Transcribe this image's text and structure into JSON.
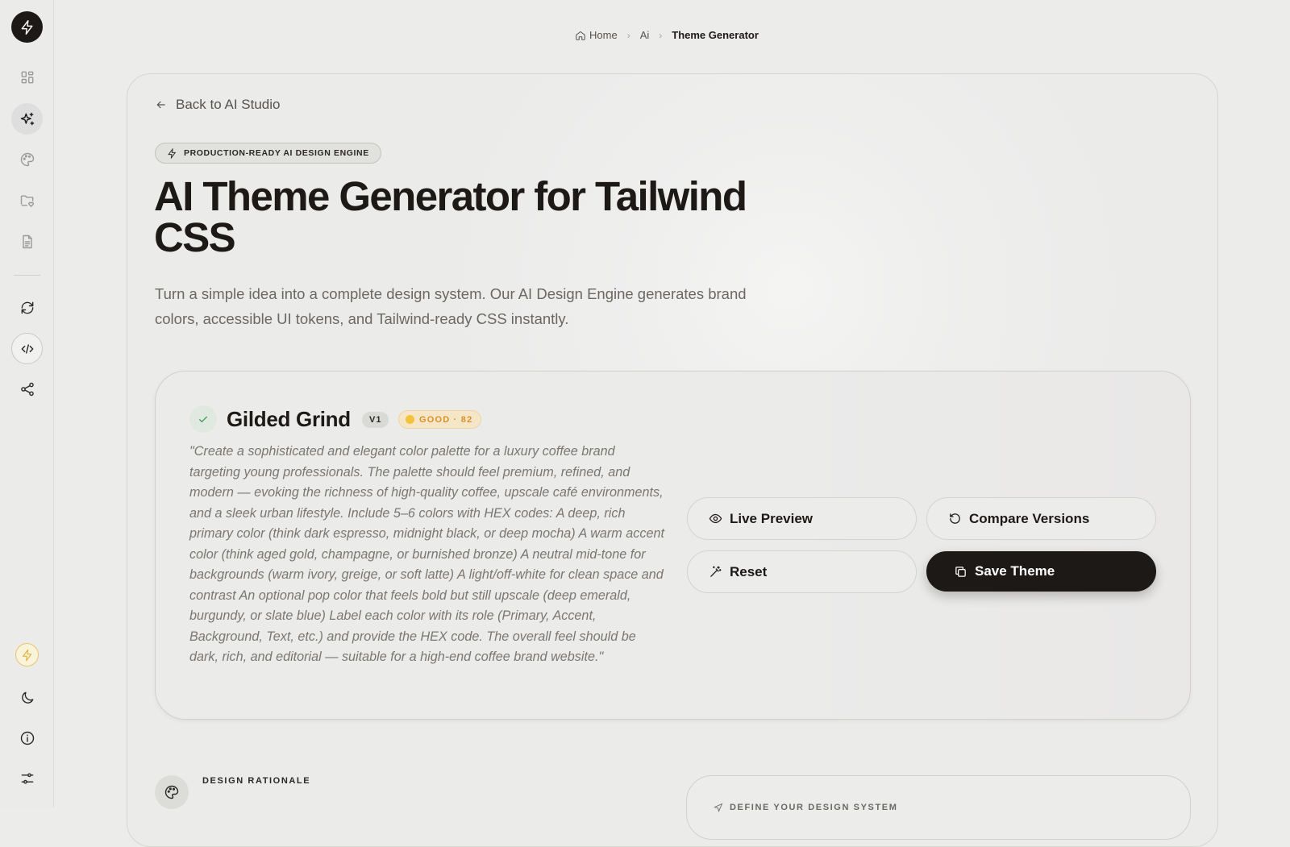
{
  "sidebar": {
    "icons": [
      "bolt-icon",
      "grid-icon",
      "sparkles-icon",
      "palette-icon",
      "folder-heart-icon",
      "document-icon",
      "refresh-icon",
      "code-icon",
      "share-icon",
      "bolt-icon",
      "moon-icon",
      "info-icon",
      "sliders-icon"
    ],
    "accent_color": "#e0b23a"
  },
  "breadcrumb": {
    "home": "Home",
    "ai": "Ai",
    "current": "Theme Generator"
  },
  "header": {
    "back_label": "Back to AI Studio",
    "badge": "PRODUCTION-READY AI DESIGN ENGINE",
    "title": "AI Theme Generator for Tailwind CSS",
    "description": "Turn a simple idea into a complete design system. Our AI Design Engine generates brand colors, accessible UI tokens, and Tailwind-ready CSS instantly."
  },
  "theme": {
    "name": "Gilded Grind",
    "version": "V1",
    "score_label": "GOOD · 82",
    "score_color": "#f3c23c",
    "prompt": "\"Create a sophisticated and elegant color palette for a luxury coffee brand targeting young professionals. The palette should feel premium, refined, and modern — evoking the richness of high-quality coffee, upscale café environments, and a sleek urban lifestyle. Include 5–6 colors with HEX codes: A deep, rich primary color (think dark espresso, midnight black, or deep mocha) A warm accent color (think aged gold, champagne, or burnished bronze) A neutral mid-tone for backgrounds (warm ivory, greige, or soft latte) A light/off-white for clean space and contrast An optional pop color that feels bold but still upscale (deep emerald, burgundy, or slate blue) Label each color with its role (Primary, Accent, Background, Text, etc.) and provide the HEX code. The overall feel should be dark, rich, and editorial — suitable for a high-end coffee brand website.\""
  },
  "actions": {
    "live_preview": "Live Preview",
    "compare_versions": "Compare Versions",
    "reset": "Reset",
    "save_theme": "Save Theme"
  },
  "sections": {
    "design_rationale": "DESIGN RATIONALE",
    "define_system": "DEFINE YOUR DESIGN SYSTEM"
  }
}
